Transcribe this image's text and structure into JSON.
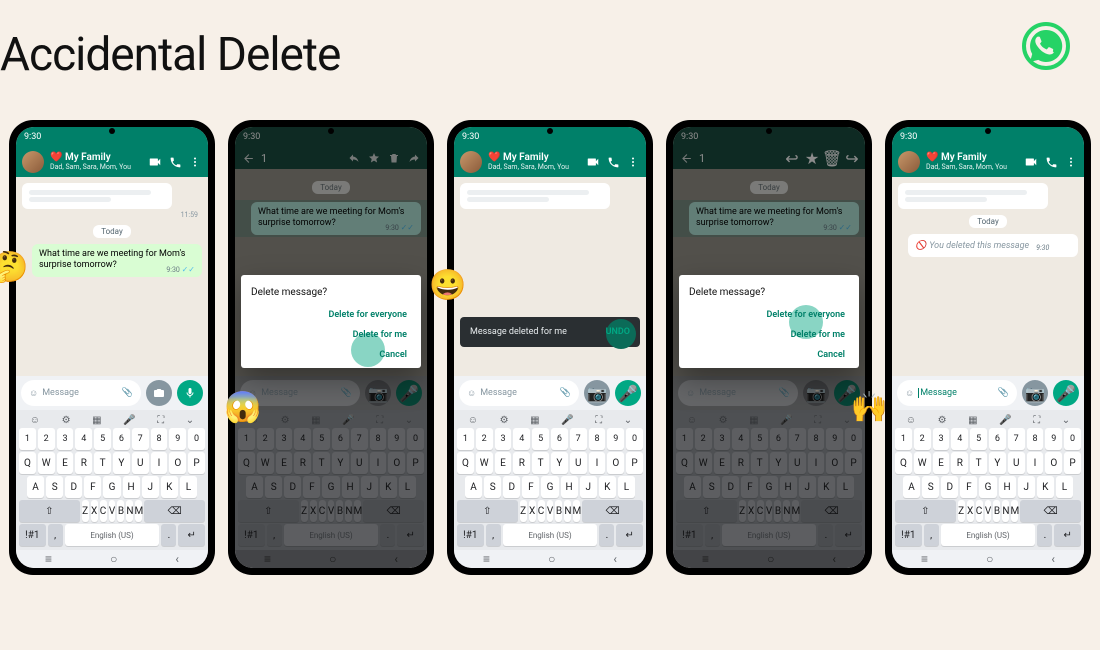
{
  "page_title": "Accidental Delete",
  "brand_color": "#25D366",
  "chat": {
    "status_time": "9:30",
    "title_emoji": "❤️",
    "title": "My Family",
    "subtitle": "Dad, Sam, Sara, Mom, You",
    "date_chip": "Today",
    "message_text": "What time are we meeting for Mom's surprise tomorrow?",
    "message_time": "9:30",
    "message_ticks": "✓✓",
    "deleted_text": "You deleted this message",
    "prev_time": "11:59"
  },
  "input": {
    "placeholder": "Message"
  },
  "dialog": {
    "title": "Delete message?",
    "btn_everyone": "Delete for everyone",
    "btn_me": "Delete for me",
    "btn_cancel": "Cancel"
  },
  "toast": {
    "text": "Message deleted for me",
    "action": "UNDO"
  },
  "selection": {
    "count": "1"
  },
  "keyboard": {
    "lang": "English (US)",
    "sym": "!#1",
    "rows": {
      "num": [
        "1",
        "2",
        "3",
        "4",
        "5",
        "6",
        "7",
        "8",
        "9",
        "0"
      ],
      "r1": [
        "Q",
        "W",
        "E",
        "R",
        "T",
        "Y",
        "U",
        "I",
        "O",
        "P"
      ],
      "r2": [
        "A",
        "S",
        "D",
        "F",
        "G",
        "H",
        "J",
        "K",
        "L"
      ],
      "r3": [
        "Z",
        "X",
        "C",
        "V",
        "B",
        "N",
        "M"
      ]
    }
  },
  "emojis": {
    "think": "🤔",
    "scream": "😱",
    "grin": "😀",
    "hands": "🙌"
  }
}
